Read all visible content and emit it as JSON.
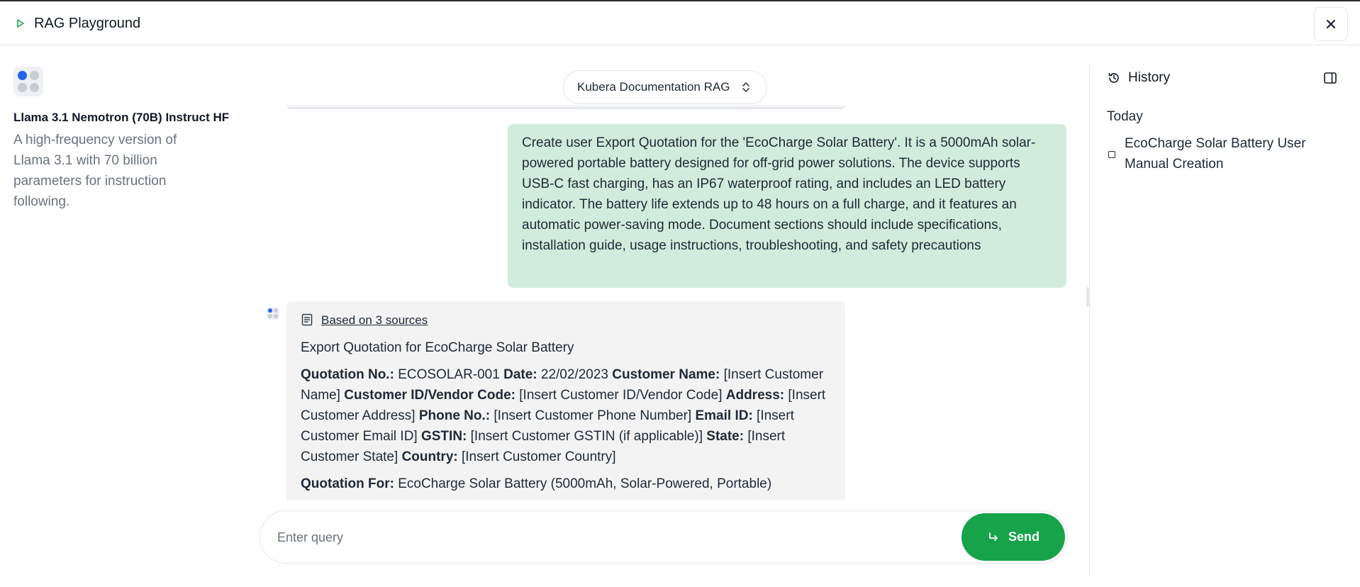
{
  "window": {
    "title": "RAG Playground",
    "close_label": "×"
  },
  "model": {
    "name": "Llama 3.1 Nemotron (70B) Instruct HF",
    "description": "A high-frequency version of Llama 3.1 with 70 billion parameters for instruction following."
  },
  "source_selector": {
    "selected": "Kubera Documentation RAG"
  },
  "conversation": {
    "user_message": "Create user Export Quotation for the 'EcoCharge Solar Battery'. It is a 5000mAh solar-powered portable battery designed for off-grid power solutions. The device supports USB-C fast charging, has an IP67 waterproof rating, and includes an LED battery indicator. The battery life extends up to 48 hours on a full charge, and it features an automatic power-saving mode. Document sections should include specifications, installation guide, usage instructions, troubleshooting, and safety precautions",
    "assistant": {
      "sources_label": "Based on 3 sources",
      "heading": "Export Quotation for EcoCharge Solar Battery",
      "fields": [
        {
          "label": "Quotation No.:",
          "value": " ECOSOLAR-001 "
        },
        {
          "label": "Date:",
          "value": " 22/02/2023 "
        },
        {
          "label": "Customer Name:",
          "value": " [Insert Customer Name] "
        },
        {
          "label": "Customer ID/Vendor Code:",
          "value": " [Insert Customer ID/Vendor Code] "
        },
        {
          "label": "Address:",
          "value": " [Insert Customer Address] "
        },
        {
          "label": "Phone No.:",
          "value": " [Insert Customer Phone Number] "
        },
        {
          "label": "Email ID:",
          "value": " [Insert Customer Email ID] "
        },
        {
          "label": "GSTIN:",
          "value": " [Insert Customer GSTIN (if applicable)] "
        },
        {
          "label": "State:",
          "value": " [Insert Customer State] "
        },
        {
          "label": "Country:",
          "value": " [Insert Customer Country]"
        }
      ],
      "quotation_for": {
        "label": "Quotation For:",
        "value": " EcoCharge Solar Battery (5000mAh, Solar-Powered, Portable)"
      }
    }
  },
  "query": {
    "placeholder": "Enter query",
    "value": ""
  },
  "send_button": {
    "label": "Send"
  },
  "history": {
    "title": "History",
    "groups": [
      {
        "label": "Today",
        "items": [
          "EcoCharge Solar Battery User Manual Creation"
        ]
      }
    ]
  },
  "colors": {
    "user_bubble": "#d1ecdc",
    "assistant_bubble": "#f3f3f3",
    "send_button": "#16a34a",
    "accent_dot": "#2563eb"
  },
  "icons": {
    "header": "play-icon",
    "close": "close-icon",
    "selector": "chevron-up-down-icon",
    "sources": "document-icon",
    "send": "return-arrow-icon",
    "history": "history-icon",
    "panel": "panel-toggle-icon"
  }
}
